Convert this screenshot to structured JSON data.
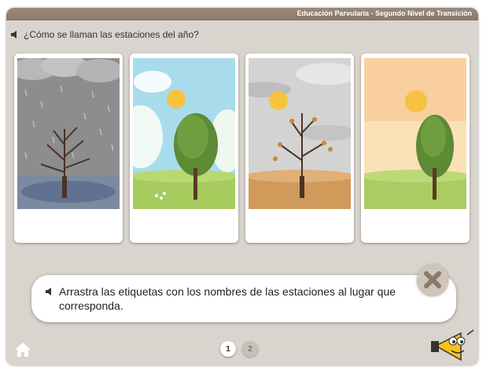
{
  "header": {
    "title": "Educación Parvularia - Segundo Nivel de Transición"
  },
  "question": {
    "text": "¿Cómo se llaman las estaciones del año?"
  },
  "cards": [
    {
      "season_scene": "winter-scene"
    },
    {
      "season_scene": "spring-scene"
    },
    {
      "season_scene": "autumn-scene"
    },
    {
      "season_scene": "summer-scene"
    }
  ],
  "instruction": {
    "text": "Arrastra las etiquetas con los nombres de las estaciones al lugar que corresponda."
  },
  "pager": {
    "pages": [
      "1",
      "2"
    ],
    "current": "1"
  },
  "colors": {
    "header": "#8b7766",
    "background": "#d9d4cd",
    "sun": "#f7c33c"
  },
  "icons": [
    "speaker-icon",
    "close-icon",
    "home-icon",
    "megaphone-mascot-icon"
  ]
}
